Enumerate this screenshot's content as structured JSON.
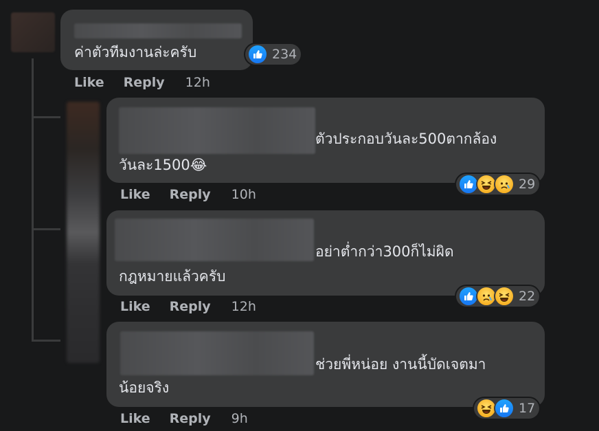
{
  "comments": [
    {
      "text": [
        "ค่าตัวทีมงานล่ะครับ"
      ],
      "like": "Like",
      "reply": "Reply",
      "time": "12h",
      "reaction_count": "234"
    },
    {
      "text": [
        "ตัวประกอบวันละ500ตากล้อง",
        "วันละ1500😂"
      ],
      "like": "Like",
      "reply": "Reply",
      "time": "10h",
      "reaction_count": "29"
    },
    {
      "text": [
        "อย่าต่ำกว่า300ก็ไม่ผิด",
        "กฎหมายแล้วครับ"
      ],
      "like": "Like",
      "reply": "Reply",
      "time": "12h",
      "reaction_count": "22"
    },
    {
      "text": [
        "ช่วยพี่หน่อย งานนี้บัดเจตมา",
        "น้อยจริง"
      ],
      "like": "Like",
      "reply": "Reply",
      "time": "9h",
      "reaction_count": "17"
    }
  ],
  "colors": {
    "background": "#18191a",
    "bubble": "#3a3b3c",
    "text": "#e4e6eb",
    "secondary": "#b0b3b8",
    "like_blue": "#1877f2",
    "emoji_yellow": "#f7b125"
  },
  "icons": [
    "like-icon",
    "haha-icon",
    "sad-icon"
  ]
}
